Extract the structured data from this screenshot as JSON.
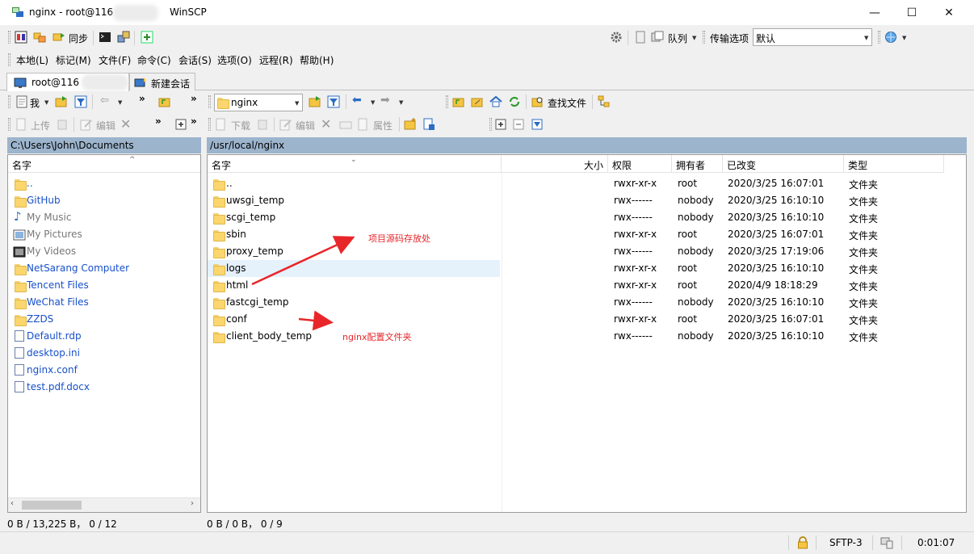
{
  "window": {
    "title": "nginx - root@116",
    "app_name": "WinSCP",
    "minimize_glyph": "—",
    "maximize_glyph": "☐",
    "close_glyph": "✕"
  },
  "toolbar1": {
    "sync_label": "同步",
    "queue_label": "队列",
    "transfer_options_label": "传输选项",
    "transfer_preset": "默认"
  },
  "menu": [
    "本地(L)",
    "标记(M)",
    "文件(F)",
    "命令(C)",
    "会话(S)",
    "选项(O)",
    "远程(R)",
    "帮助(H)"
  ],
  "tabs": {
    "session_label": "root@116",
    "new_session_label": "新建会话"
  },
  "local_toolbar": {
    "drive_label": "我",
    "upload_label": "上传",
    "edit_label": "编辑"
  },
  "remote_toolbar": {
    "dir_combo": "nginx",
    "find_files_label": "查找文件",
    "download_label": "下载",
    "edit_label": "编辑",
    "properties_label": "属性"
  },
  "local_panel": {
    "path": "C:\\Users\\John\\Documents",
    "columns": [
      "名字"
    ],
    "items": [
      {
        "name": "..",
        "kind": "up"
      },
      {
        "name": "GitHub",
        "kind": "folder"
      },
      {
        "name": "My Music",
        "kind": "music"
      },
      {
        "name": "My Pictures",
        "kind": "pictures"
      },
      {
        "name": "My Videos",
        "kind": "videos"
      },
      {
        "name": "NetSarang Computer",
        "kind": "folder"
      },
      {
        "name": "Tencent Files",
        "kind": "folder"
      },
      {
        "name": "WeChat Files",
        "kind": "folder"
      },
      {
        "name": "ZZDS",
        "kind": "folder"
      },
      {
        "name": "Default.rdp",
        "kind": "file"
      },
      {
        "name": "desktop.ini",
        "kind": "file"
      },
      {
        "name": "nginx.conf",
        "kind": "file"
      },
      {
        "name": "test.pdf.docx",
        "kind": "file"
      }
    ],
    "status": "0 B / 13,225 B，  0 / 12"
  },
  "remote_panel": {
    "path": "/usr/local/nginx",
    "columns": {
      "name": "名字",
      "size": "大小",
      "perms": "权限",
      "owner": "拥有者",
      "changed": "已改变",
      "type": "类型"
    },
    "rows": [
      {
        "name": "..",
        "perms": "rwxr-xr-x",
        "owner": "root",
        "changed": "2020/3/25 16:07:01",
        "type": "文件夹",
        "kind": "up"
      },
      {
        "name": "uwsgi_temp",
        "perms": "rwx------",
        "owner": "nobody",
        "changed": "2020/3/25 16:10:10",
        "type": "文件夹",
        "kind": "folder"
      },
      {
        "name": "scgi_temp",
        "perms": "rwx------",
        "owner": "nobody",
        "changed": "2020/3/25 16:10:10",
        "type": "文件夹",
        "kind": "folder"
      },
      {
        "name": "sbin",
        "perms": "rwxr-xr-x",
        "owner": "root",
        "changed": "2020/3/25 16:07:01",
        "type": "文件夹",
        "kind": "folder"
      },
      {
        "name": "proxy_temp",
        "perms": "rwx------",
        "owner": "nobody",
        "changed": "2020/3/25 17:19:06",
        "type": "文件夹",
        "kind": "folder"
      },
      {
        "name": "logs",
        "perms": "rwxr-xr-x",
        "owner": "root",
        "changed": "2020/3/25 16:10:10",
        "type": "文件夹",
        "kind": "folder"
      },
      {
        "name": "html",
        "perms": "rwxr-xr-x",
        "owner": "root",
        "changed": "2020/4/9 18:18:29",
        "type": "文件夹",
        "kind": "folder"
      },
      {
        "name": "fastcgi_temp",
        "perms": "rwx------",
        "owner": "nobody",
        "changed": "2020/3/25 16:10:10",
        "type": "文件夹",
        "kind": "folder"
      },
      {
        "name": "conf",
        "perms": "rwxr-xr-x",
        "owner": "root",
        "changed": "2020/3/25 16:07:01",
        "type": "文件夹",
        "kind": "folder"
      },
      {
        "name": "client_body_temp",
        "perms": "rwx------",
        "owner": "nobody",
        "changed": "2020/3/25 16:10:10",
        "type": "文件夹",
        "kind": "folder"
      }
    ],
    "status": "0 B / 0 B，  0 / 9"
  },
  "annotations": {
    "html_note": "项目源码存放处",
    "conf_note": "nginx配置文件夹",
    "color": "#e8262a"
  },
  "statusbar": {
    "protocol": "SFTP-3",
    "elapsed": "0:01:07"
  },
  "colors": {
    "path_header": "#9cb4cc",
    "link_blue": "#1750c9"
  }
}
